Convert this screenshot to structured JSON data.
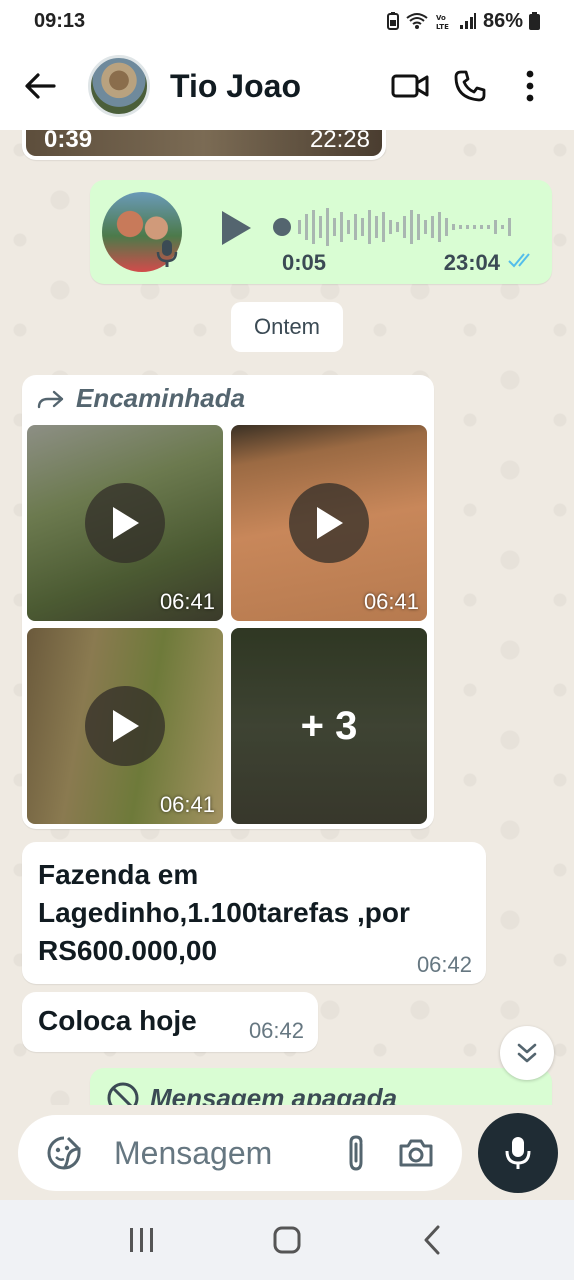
{
  "status_bar": {
    "time": "09:13",
    "battery": "86%"
  },
  "header": {
    "contact_name": "Tio Joao"
  },
  "chat": {
    "previous_media": {
      "duration": "0:39",
      "time": "22:28"
    },
    "voice_message": {
      "duration": "0:05",
      "time": "23:04"
    },
    "date_separator": "Ontem",
    "album": {
      "forwarded_label": "Encaminhada",
      "tiles": [
        {
          "time": "06:41"
        },
        {
          "time": "06:41"
        },
        {
          "time": "06:41"
        }
      ],
      "more_count": "+ 3"
    },
    "messages": [
      {
        "text": "Fazenda em Lagedinho,1.100tarefas ,por RS600.000,00",
        "time": "06:42"
      },
      {
        "text": "Coloca hoje",
        "time": "06:42"
      }
    ],
    "deleted_message": "Mensagem apagada"
  },
  "composer": {
    "placeholder": "Mensagem"
  },
  "colors": {
    "outgoing_bubble": "#d9fdd3",
    "incoming_bubble": "#ffffff",
    "read_ticks": "#53bdeb",
    "mic_button": "#1f2c34"
  },
  "icons": [
    "back-arrow-icon",
    "video-call-icon",
    "phone-icon",
    "more-vert-icon",
    "play-icon",
    "mic-icon",
    "double-check-icon",
    "forward-icon",
    "chevrons-down-icon",
    "sticker-icon",
    "attach-icon",
    "camera-icon",
    "blocked-icon"
  ]
}
